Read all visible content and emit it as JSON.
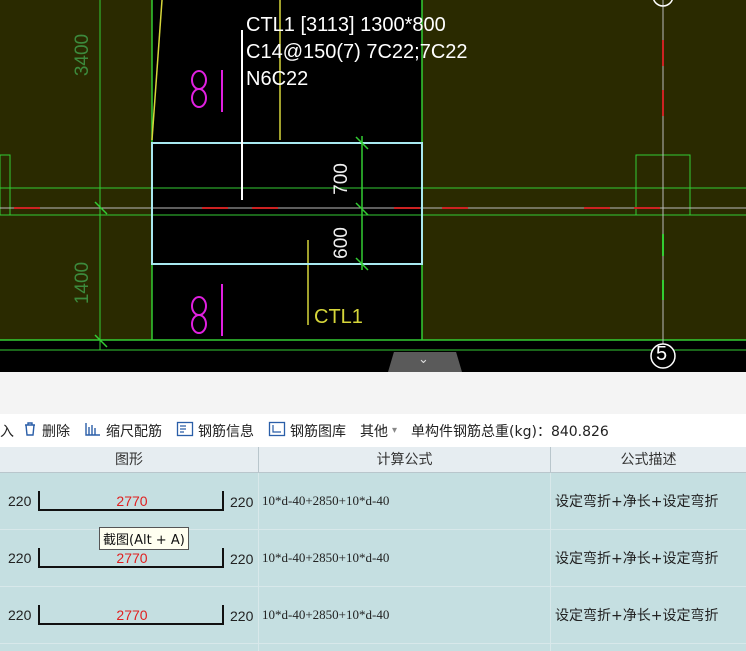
{
  "cad": {
    "beam_label_lines": [
      "CTL1 [3113] 1300*800",
      "C14@150(7) 7C22;7C22",
      "N6C22"
    ],
    "dim_3400": "3400",
    "dim_1400": "1400",
    "dim_700": "700",
    "dim_600": "600",
    "axis_5": "5",
    "ctl1_label": "CTL1",
    "collapse_glyph": "⌄"
  },
  "toolbar": {
    "partial_label": "入",
    "delete_label": "删除",
    "scale_rebar_label": "缩尺配筋",
    "rebar_info_label": "钢筋信息",
    "rebar_library_label": "钢筋图库",
    "other_label": "其他",
    "total_weight_label": "单构件钢筋总重(kg)：840.826"
  },
  "table": {
    "headers": [
      "图形",
      "计算公式",
      "公式描述"
    ],
    "rows": [
      {
        "left": "220",
        "length": "2770",
        "right": "220",
        "formula": "10*d-40+2850+10*d-40",
        "description": "设定弯折+净长+设定弯折"
      },
      {
        "left": "220",
        "length": "2770",
        "right": "220",
        "formula": "10*d-40+2850+10*d-40",
        "description": "设定弯折+净长+设定弯折"
      },
      {
        "left": "220",
        "length": "2770",
        "right": "220",
        "formula": "10*d-40+2850+10*d-40",
        "description": "设定弯折+净长+设定弯折"
      }
    ]
  },
  "tooltip": "截图(Alt + A)",
  "colors": {
    "grid_bg": "#2a2a00",
    "beam_outline": "#a8e8f0",
    "grid_line": "#33cc33",
    "red_dash": "#cc2222",
    "row_bg": "#c5dfe1"
  }
}
